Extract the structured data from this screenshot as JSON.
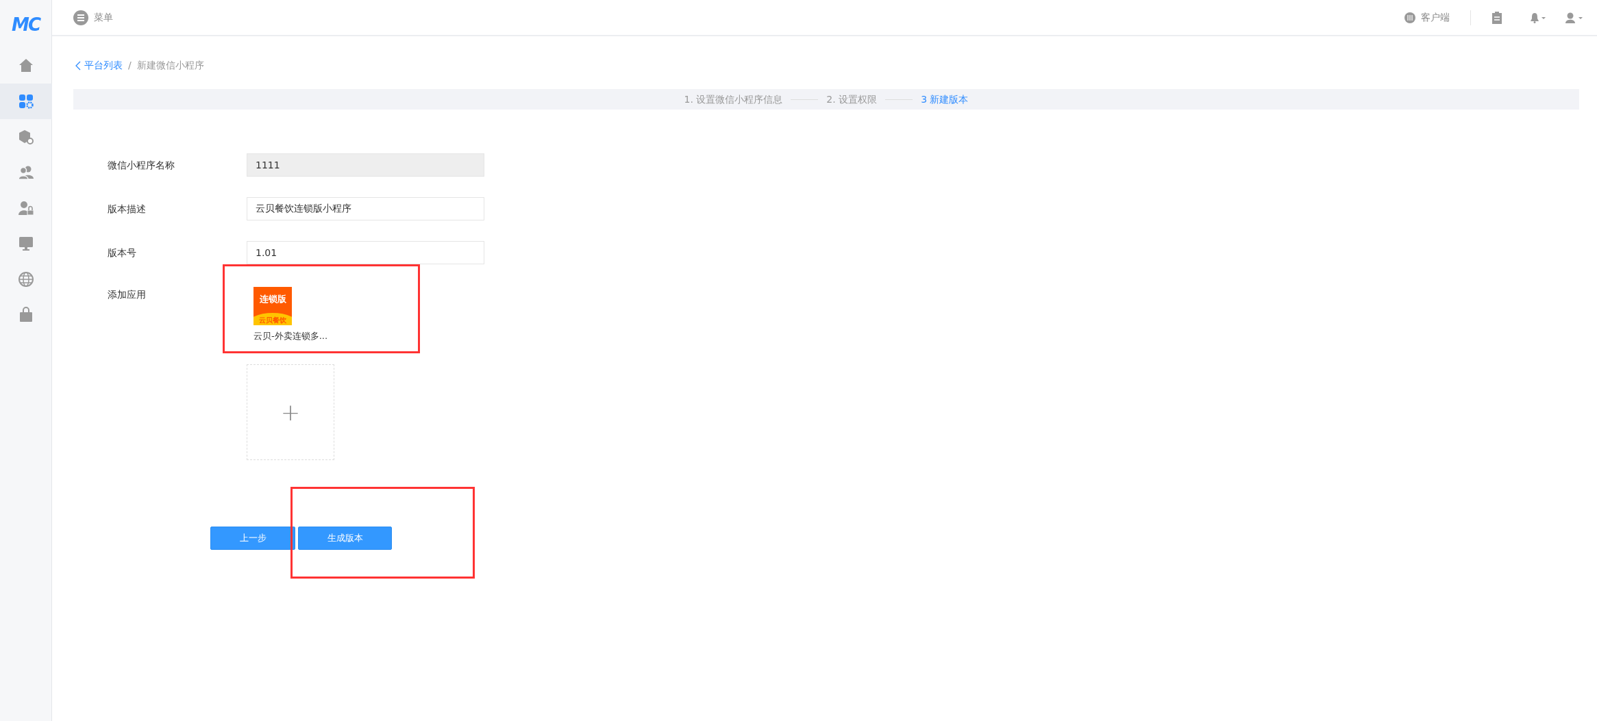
{
  "sidebar": {
    "logo": "MC",
    "items": [
      {
        "selected": false
      },
      {
        "selected": true
      },
      {
        "selected": false
      },
      {
        "selected": false
      },
      {
        "selected": false
      },
      {
        "selected": false
      },
      {
        "selected": false
      },
      {
        "selected": false
      }
    ]
  },
  "topbar": {
    "menu_label": "菜单",
    "client_label": "客户端"
  },
  "breadcrumb_separator": "/",
  "breadcrumb": [
    {
      "label": "平台列表",
      "kind": "link"
    },
    {
      "label": "新建微信小程序",
      "kind": "current"
    }
  ],
  "steps": [
    {
      "label": "1. 设置微信小程序信息",
      "selected": false
    },
    {
      "label": "2. 设置权限",
      "selected": false
    },
    {
      "label": "3 新建版本",
      "selected": true
    }
  ],
  "form": [
    {
      "label": "微信小程序名称",
      "value": "1111",
      "disabled": true
    },
    {
      "label": "版本描述",
      "value": "云贝餐饮连锁版小程序",
      "disabled": false
    },
    {
      "label": "版本号",
      "value": "1.01",
      "disabled": false
    }
  ],
  "apps": {
    "label": "添加应用",
    "items": [
      {
        "logo_title": "连锁版",
        "logo_subtitle": "云贝餐饮",
        "name": "云贝-外卖连锁多..."
      }
    ],
    "add_symbol": "+"
  },
  "buttons": [
    {
      "label": "上一步"
    },
    {
      "label": "生成版本"
    }
  ],
  "annotations": [
    {
      "kind": "rectangle",
      "color": "#ff3333"
    },
    {
      "kind": "rectangle",
      "color": "#ff3333"
    }
  ]
}
